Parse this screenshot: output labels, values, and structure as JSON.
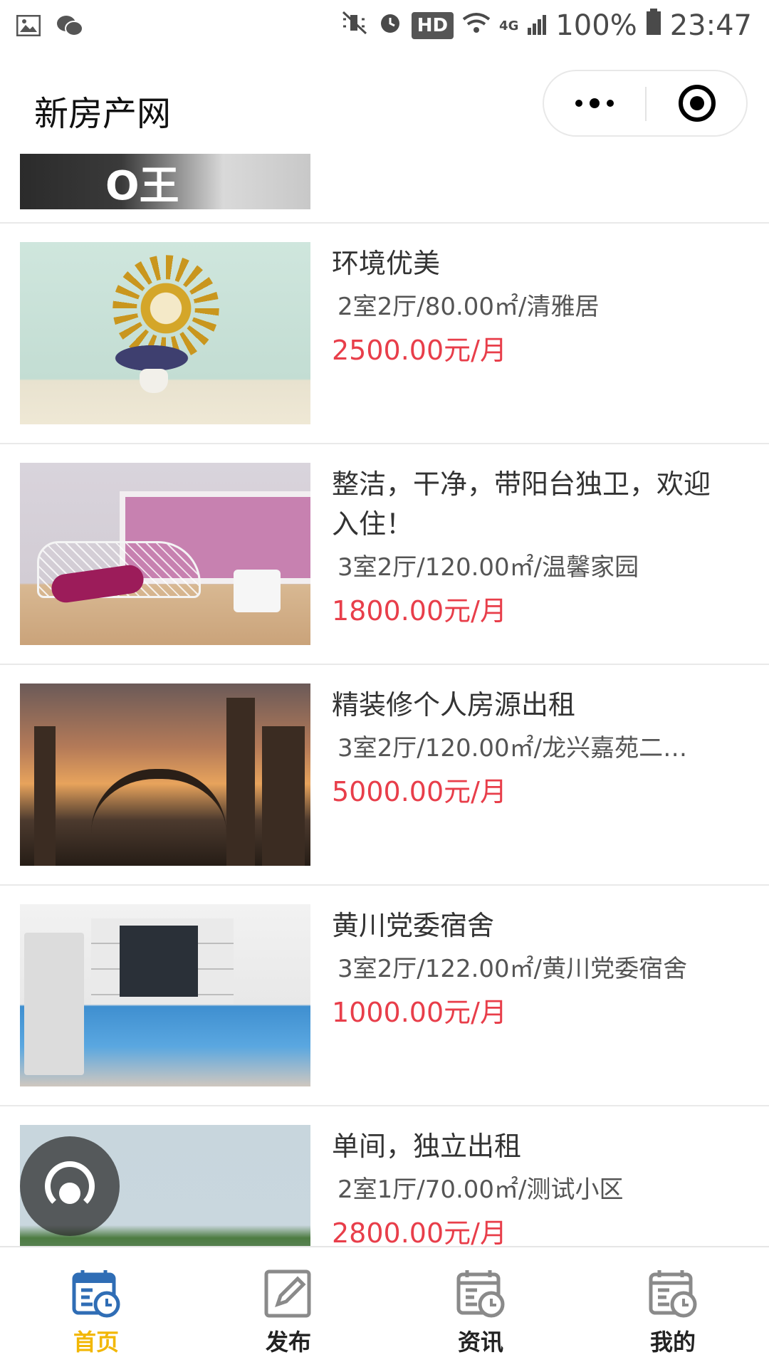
{
  "status_bar": {
    "left_icons": [
      "image-icon",
      "wechat-icon"
    ],
    "hd": "HD",
    "network": "4G",
    "battery": "100%",
    "time": "23:47"
  },
  "header": {
    "title": "新房产网"
  },
  "listings": [
    {
      "title": "环境优美",
      "meta": "2室2厅/80.00㎡/清雅居",
      "price": "2500.00元/月"
    },
    {
      "title": "整洁，干净，带阳台独卫，欢迎入住！",
      "meta": "3室2厅/120.00㎡/温馨家园",
      "price": "1800.00元/月"
    },
    {
      "title": "精装修个人房源出租",
      "meta": "3室2厅/120.00㎡/龙兴嘉苑二…",
      "price": "5000.00元/月"
    },
    {
      "title": "黄川党委宿舍",
      "meta": "3室2厅/122.00㎡/黄川党委宿舍",
      "price": "1000.00元/月"
    },
    {
      "title": "单间，独立出租",
      "meta": "2室1厅/70.00㎡/测试小区",
      "price": "2800.00元/月"
    }
  ],
  "tabs": [
    {
      "label": "首页",
      "icon": "calendar-clock-icon",
      "active": true
    },
    {
      "label": "发布",
      "icon": "edit-icon",
      "active": false
    },
    {
      "label": "资讯",
      "icon": "calendar-clock-icon",
      "active": false
    },
    {
      "label": "我的",
      "icon": "calendar-clock-icon",
      "active": false
    }
  ],
  "colors": {
    "price": "#e83e4a",
    "active_tab": "#f2b705",
    "active_icon": "#2f6db5",
    "inactive_icon": "#8a8a8a"
  }
}
